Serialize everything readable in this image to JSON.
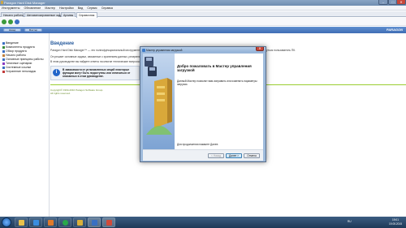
{
  "window": {
    "title": "Paragon Hard Disk Manager",
    "minimize": "–",
    "maximize": "□",
    "close": "✕"
  },
  "menu": [
    "Инструменты",
    "Обновление",
    "Мастер",
    "Настройки",
    "Вид",
    "Сервис",
    "Справка"
  ],
  "tabs": [
    "Начало работы",
    "Автоматизированные задачи",
    "Архивы",
    "Справочник"
  ],
  "bluebar": {
    "buttons": [
      "Назад",
      "Мастер"
    ],
    "brand": "PARAGON"
  },
  "sidebar": {
    "items": [
      {
        "label": "Введение",
        "icon": "page-icon",
        "color": "#3a6fc2"
      },
      {
        "label": "Компоненты продукта",
        "icon": "component-icon",
        "color": "#3a8c3a"
      },
      {
        "label": "Обзор продукта",
        "icon": "overview-icon",
        "color": "#3a6fc2"
      },
      {
        "label": "Начало работы",
        "icon": "start-icon",
        "color": "#c2803a"
      },
      {
        "label": "Основные принципы работы",
        "icon": "book-icon",
        "color": "#3a6fc2"
      },
      {
        "label": "Типичные сценарии",
        "icon": "scenario-icon",
        "color": "#8a3ac2"
      },
      {
        "label": "Системные ссылки",
        "icon": "link-icon",
        "color": "#3a6fc2"
      },
      {
        "label": "Устранение неполадок",
        "icon": "tools-icon",
        "color": "#c23a3a"
      }
    ]
  },
  "main": {
    "heading": "Введение",
    "para1": "Paragon Hard Disk Manager™ — это полнофункциональный инструмент, представляющий собой комплексное решение для большинства проблем, с которыми может столкнуться пользователь ПК.",
    "para2": "Он решает основные задачи, связанные с хранением данных, резервным копированием, восстановлением системы и обслуживанием жестких дисков.",
    "para3": "В этом руководстве вы найдете ответы на многие технические вопросы.",
    "info": "В зависимости от установленных опций некоторые функции могут быть недоступны или отличаться от описанных в этом руководстве.",
    "copyright": "Copyright© 1994-2010 Paragon Software Group.",
    "rights": "All rights reserved."
  },
  "dialog": {
    "title": "Мастер управления загрузкой",
    "heading": "Добро пожаловать в Мастер управления загрузкой",
    "text": "Данный Мастер позволит вам исправить или изменить параметры загрузки.",
    "continue": "Для продолжения нажмите Далее.",
    "buttons": {
      "back": "< Назад",
      "next": "Далее >",
      "cancel": "Отмена"
    }
  },
  "taskbar": {
    "apps": [
      {
        "name": "explorer",
        "color": "#e8c04a"
      },
      {
        "name": "ie",
        "color": "#3a8de0"
      },
      {
        "name": "media",
        "color": "#e07a2a"
      },
      {
        "name": "chrome",
        "color": "#2aa84a"
      },
      {
        "name": "folder",
        "color": "#d9b03a"
      },
      {
        "name": "paragon",
        "color": "#3a6fc2"
      },
      {
        "name": "app",
        "color": "#d04a3a"
      }
    ],
    "lang": "RU",
    "time": "19:01",
    "date": "19.05.2015"
  },
  "colors": {
    "accent": "#3f6db4",
    "heading": "#2a5d9e",
    "copyright": "#6a8c2c"
  }
}
